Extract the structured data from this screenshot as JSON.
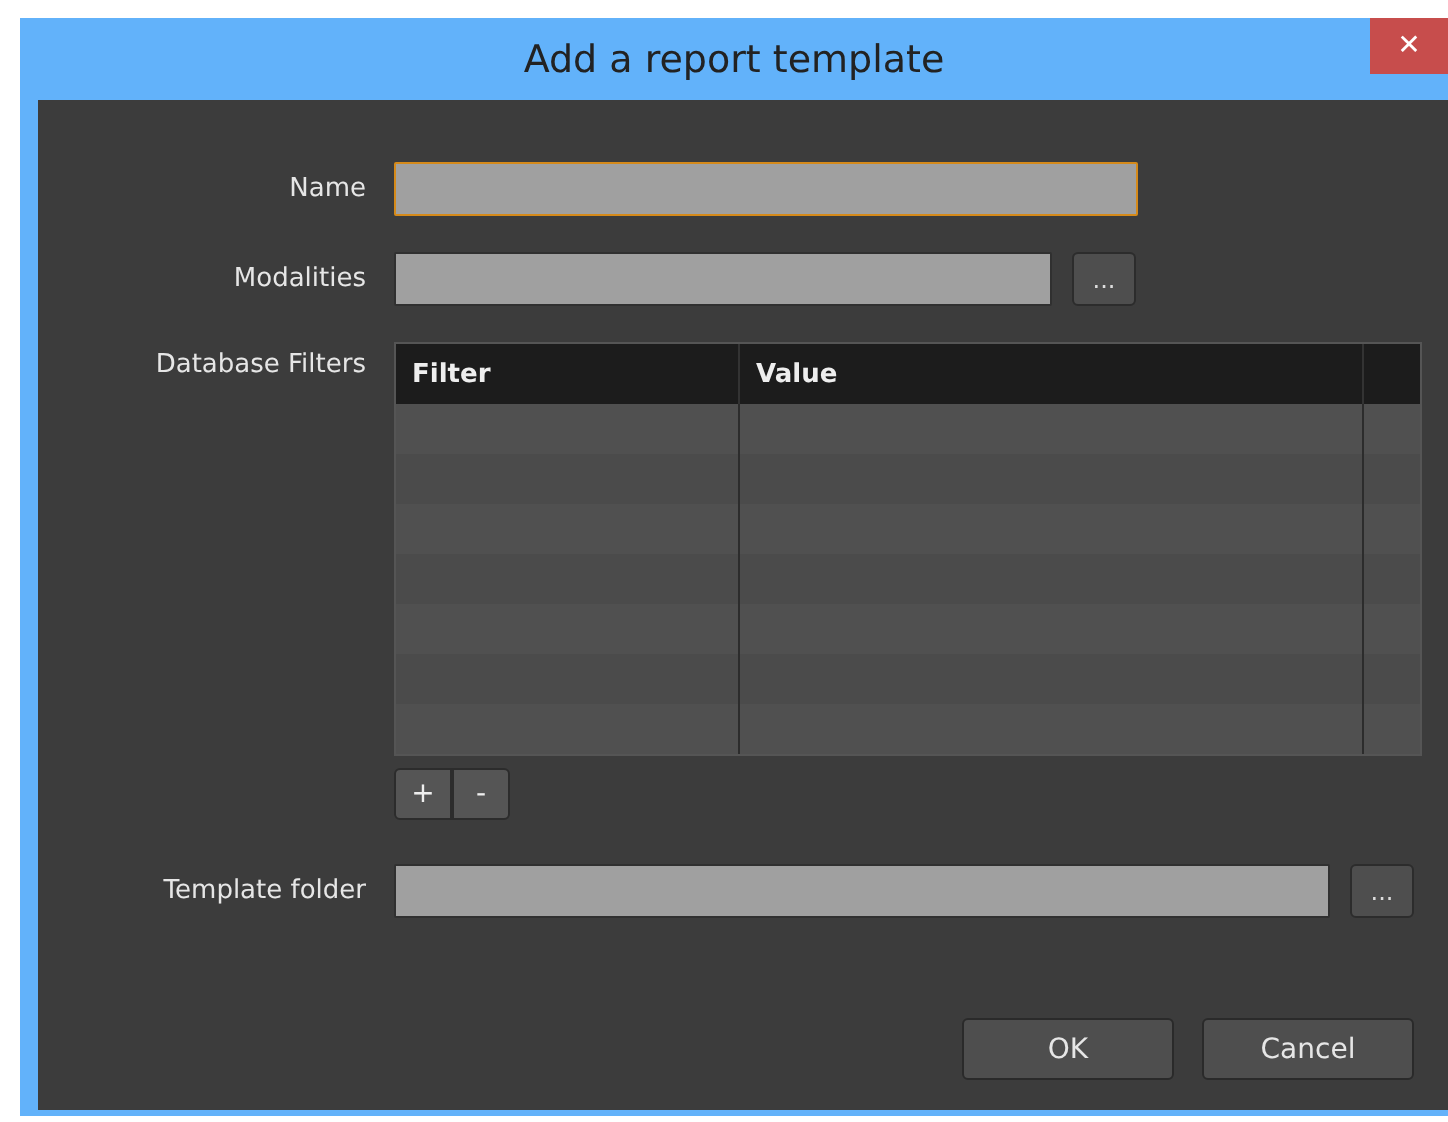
{
  "window": {
    "title": "Add a report template",
    "close": "✕"
  },
  "fields": [
    {
      "label": "Name",
      "kind": "text",
      "focused": true
    },
    {
      "label": "Modalities",
      "kind": "browse",
      "focused": false,
      "button": "..."
    }
  ],
  "filters": {
    "label": "Database Filters",
    "columns": [
      "Filter",
      "Value"
    ],
    "buttons": [
      "+",
      "-"
    ]
  },
  "folder": {
    "label": "Template folder",
    "focused": false,
    "button": "..."
  },
  "buttons": [
    "OK",
    "Cancel"
  ]
}
